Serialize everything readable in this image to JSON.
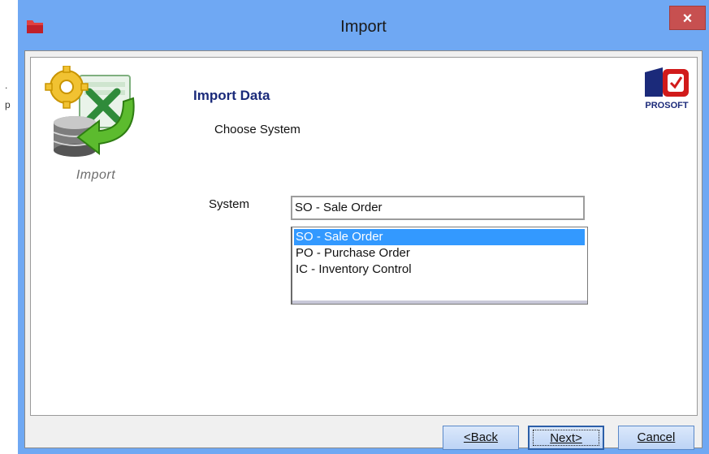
{
  "background": {
    "left_chars": [
      ".",
      "p"
    ]
  },
  "window": {
    "title": "Import",
    "close_glyph": "×",
    "title_icon": "red-folder-icon"
  },
  "header": {
    "icon": "import-gear-excel-database-icon",
    "icon_label": "Import",
    "heading": "Import Data",
    "subheading": "Choose System",
    "logo": "prosoft-logo",
    "logo_text": "PROSOFT"
  },
  "form": {
    "system_label": "System",
    "system_value": "SO - Sale Order",
    "options": [
      {
        "label": "SO - Sale Order",
        "selected": true
      },
      {
        "label": "PO - Purchase Order",
        "selected": false
      },
      {
        "label": "IC - Inventory Control",
        "selected": false
      }
    ]
  },
  "buttons": {
    "back": "<Back",
    "next": "Next>",
    "cancel": "Cancel"
  },
  "colors": {
    "titlebar": "#6fa8f3",
    "close": "#c75050",
    "selection": "#3399ff",
    "heading": "#1a2a7a"
  }
}
